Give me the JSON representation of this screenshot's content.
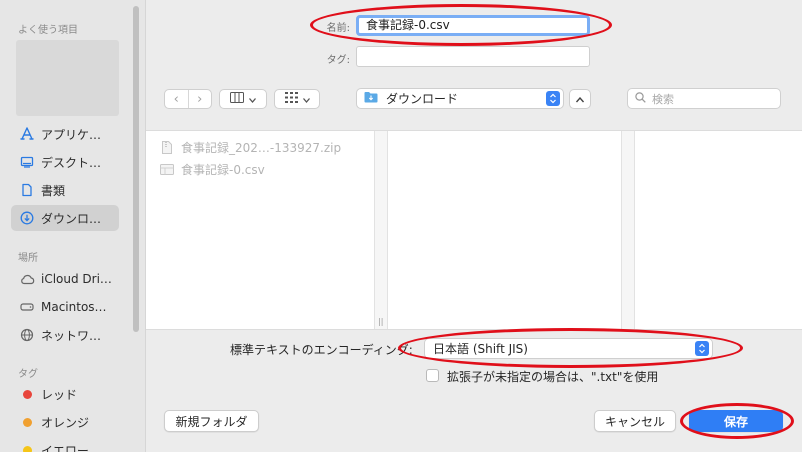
{
  "sidebar": {
    "favorites_header": "よく使う項目",
    "locations_header": "場所",
    "tags_header": "タグ",
    "favorites": [
      {
        "label": "アプリケ…",
        "icon": "applications-icon"
      },
      {
        "label": "デスクト…",
        "icon": "desktop-icon"
      },
      {
        "label": "書類",
        "icon": "documents-icon"
      },
      {
        "label": "ダウンロ…",
        "icon": "downloads-icon",
        "selected": true
      }
    ],
    "locations": [
      {
        "label": "iCloud Dri…",
        "icon": "icloud-icon"
      },
      {
        "label": "Macintos…",
        "icon": "disk-icon"
      },
      {
        "label": "ネットワ…",
        "icon": "network-icon"
      }
    ],
    "tags": [
      {
        "label": "レッド",
        "color": "#e8453c"
      },
      {
        "label": "オレンジ",
        "color": "#f0a030"
      },
      {
        "label": "イエロー",
        "color": "#f5c518"
      }
    ]
  },
  "save": {
    "name_label": "名前:",
    "name_value": "食事記録-0.csv",
    "tag_label": "タグ:",
    "tag_value": ""
  },
  "toolbar": {
    "back": "‹",
    "forward": "›",
    "view_columns": "▥",
    "view_grid": "▦",
    "location": "ダウンロード",
    "collapse": "⌃",
    "search_placeholder": "検索"
  },
  "files": [
    {
      "name": "食事記録_202…-133927.zip",
      "icon": "zip-file-icon"
    },
    {
      "name": "食事記録-0.csv",
      "icon": "csv-file-icon"
    }
  ],
  "options": {
    "encoding_label": "標準テキストのエンコーディング:",
    "encoding_value": "日本語 (Shift JIS)",
    "checkbox_label": "拡張子が未指定の場合は、\".txt\"を使用",
    "checkbox_checked": false
  },
  "buttons": {
    "new_folder": "新規フォルダ",
    "cancel": "キャンセル",
    "save": "保存"
  },
  "colors": {
    "accent": "#2f7ef5",
    "annotation_red": "#e00f1a"
  }
}
